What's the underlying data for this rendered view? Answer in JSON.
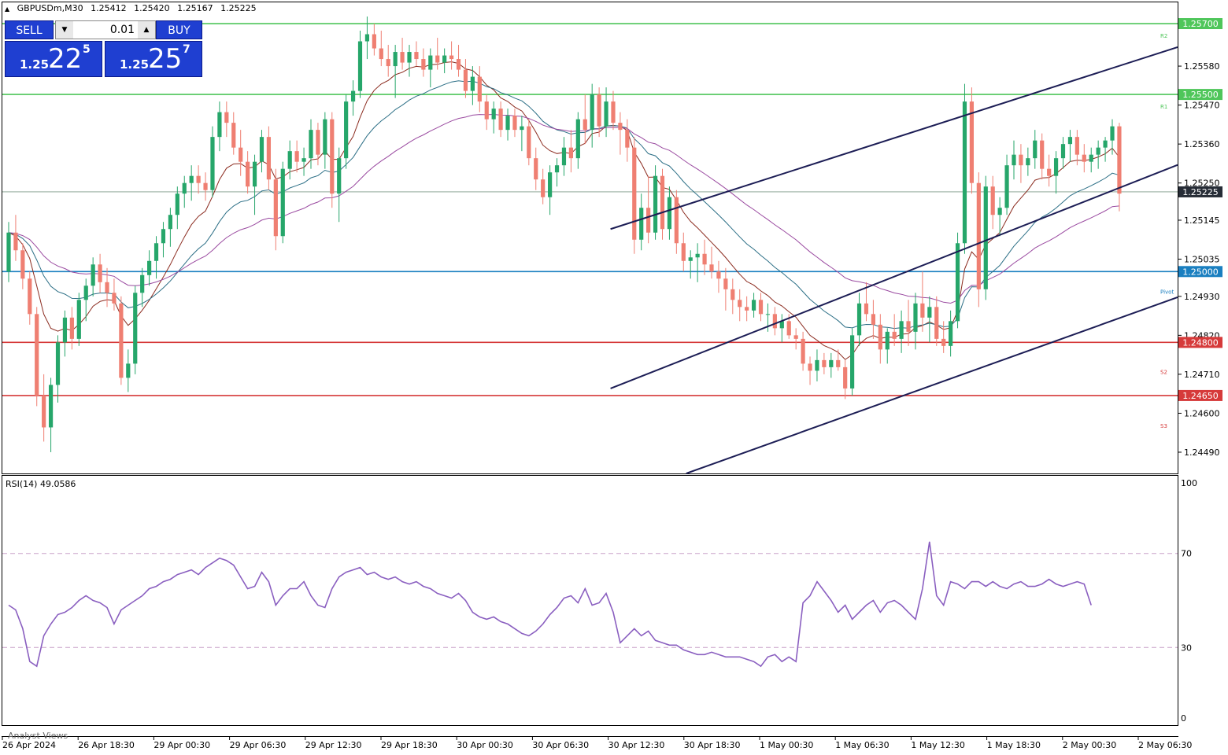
{
  "header": {
    "symbol": "GBPUSDm,M30",
    "open": "1.25412",
    "high": "1.25420",
    "low": "1.25167",
    "close": "1.25225"
  },
  "trade_panel": {
    "sell_label": "SELL",
    "buy_label": "BUY",
    "lot": "0.01",
    "sell_prefix": "1.25",
    "sell_big": "22",
    "sell_sup": "5",
    "buy_prefix": "1.25",
    "buy_big": "25",
    "buy_sup": "7"
  },
  "colors": {
    "bull": "#26a66a",
    "bear": "#ef7f72",
    "resistance": "#4fc65a",
    "support": "#d63a3a",
    "pivot": "#1a7fc0",
    "channel": "#1c1d55",
    "ma_fast": "#8b2b1f",
    "ma_mid": "#2c6f86",
    "ma_slow": "#9a4aa0",
    "rsi": "#8a5fc0"
  },
  "chart_data": {
    "type": "candlestick",
    "price_axis": {
      "ticks": [
        "1.25580",
        "1.25470",
        "1.25360",
        "1.25250",
        "1.25145",
        "1.25035",
        "1.24930",
        "1.24820",
        "1.24710",
        "1.24600",
        "1.24490"
      ],
      "range": [
        1.2443,
        1.2576
      ]
    },
    "time_axis": {
      "labels": [
        "26 Apr 2024",
        "26 Apr 18:30",
        "29 Apr 00:30",
        "29 Apr 06:30",
        "29 Apr 12:30",
        "29 Apr 18:30",
        "30 Apr 00:30",
        "30 Apr 06:30",
        "30 Apr 12:30",
        "30 Apr 18:30",
        "1 May 00:30",
        "1 May 06:30",
        "1 May 12:30",
        "1 May 18:30",
        "2 May 00:30",
        "2 May 06:30"
      ]
    },
    "levels": [
      {
        "label": "1.25700",
        "value": 1.257,
        "kind": "resistance",
        "tag": "R2"
      },
      {
        "label": "1.25500",
        "value": 1.255,
        "kind": "resistance",
        "tag": "R1"
      },
      {
        "label": "1.25000",
        "value": 1.25,
        "kind": "pivot",
        "tag": "Pivot"
      },
      {
        "label": "1.24800",
        "value": 1.248,
        "kind": "support",
        "tag": "S2"
      },
      {
        "label": "1.24650",
        "value": 1.2465,
        "kind": "support",
        "tag": "S3"
      }
    ],
    "current_price": {
      "label": "1.25225",
      "value": 1.25225
    },
    "channel_lines": [
      {
        "from": [
          "30 Apr 12:30",
          1.2512
        ],
        "to": [
          "2 May 06:30",
          1.256
        ]
      },
      {
        "from": [
          "30 Apr 12:30",
          1.2467
        ],
        "to": [
          "2 May 06:30",
          1.2526
        ]
      },
      {
        "from": [
          "30 Apr 18:30",
          1.2443
        ],
        "to": [
          "2 May 06:30",
          1.2489
        ]
      }
    ],
    "candles": [
      [
        1.25,
        1.2514,
        1.2497,
        1.2511
      ],
      [
        1.2511,
        1.2516,
        1.2503,
        1.2506
      ],
      [
        1.2506,
        1.2508,
        1.2495,
        1.2498
      ],
      [
        1.2498,
        1.25,
        1.2485,
        1.2488
      ],
      [
        1.2488,
        1.249,
        1.2462,
        1.2465
      ],
      [
        1.2465,
        1.2471,
        1.2452,
        1.2456
      ],
      [
        1.2456,
        1.247,
        1.2449,
        1.2468
      ],
      [
        1.2468,
        1.2482,
        1.2463,
        1.248
      ],
      [
        1.248,
        1.2489,
        1.2476,
        1.2487
      ],
      [
        1.2487,
        1.249,
        1.2478,
        1.2481
      ],
      [
        1.2481,
        1.2494,
        1.2479,
        1.2492
      ],
      [
        1.2492,
        1.2498,
        1.2486,
        1.2496
      ],
      [
        1.2496,
        1.2504,
        1.2493,
        1.2502
      ],
      [
        1.2502,
        1.2505,
        1.2494,
        1.2497
      ],
      [
        1.2497,
        1.2501,
        1.249,
        1.2494
      ],
      [
        1.2494,
        1.2498,
        1.2489,
        1.2491
      ],
      [
        1.2491,
        1.2493,
        1.2468,
        1.247
      ],
      [
        1.247,
        1.2478,
        1.2466,
        1.2474
      ],
      [
        1.2474,
        1.2496,
        1.2471,
        1.2494
      ],
      [
        1.2494,
        1.2501,
        1.249,
        1.2499
      ],
      [
        1.2499,
        1.2506,
        1.2496,
        1.2503
      ],
      [
        1.2503,
        1.251,
        1.2498,
        1.2508
      ],
      [
        1.2508,
        1.2514,
        1.2504,
        1.2512
      ],
      [
        1.2512,
        1.2518,
        1.2507,
        1.2516
      ],
      [
        1.2516,
        1.2524,
        1.2512,
        1.2522
      ],
      [
        1.2522,
        1.2527,
        1.2518,
        1.2525
      ],
      [
        1.2525,
        1.253,
        1.252,
        1.2527
      ],
      [
        1.2527,
        1.253,
        1.2522,
        1.2525
      ],
      [
        1.2525,
        1.2528,
        1.252,
        1.2523
      ],
      [
        1.2523,
        1.2541,
        1.2521,
        1.2538
      ],
      [
        1.2538,
        1.2548,
        1.2534,
        1.2545
      ],
      [
        1.2545,
        1.2548,
        1.2538,
        1.2542
      ],
      [
        1.2542,
        1.2545,
        1.2533,
        1.2535
      ],
      [
        1.2535,
        1.254,
        1.2527,
        1.2531
      ],
      [
        1.2531,
        1.2534,
        1.2522,
        1.2524
      ],
      [
        1.2524,
        1.2533,
        1.2516,
        1.2531
      ],
      [
        1.2531,
        1.254,
        1.2528,
        1.2538
      ],
      [
        1.2538,
        1.2541,
        1.2523,
        1.2526
      ],
      [
        1.2526,
        1.2529,
        1.2506,
        1.251
      ],
      [
        1.251,
        1.2531,
        1.2508,
        1.2529
      ],
      [
        1.2529,
        1.2537,
        1.2526,
        1.2534
      ],
      [
        1.2534,
        1.2537,
        1.2528,
        1.2531
      ],
      [
        1.2531,
        1.2535,
        1.2527,
        1.2532
      ],
      [
        1.2532,
        1.2543,
        1.2529,
        1.254
      ],
      [
        1.254,
        1.2542,
        1.253,
        1.2533
      ],
      [
        1.2533,
        1.2545,
        1.2529,
        1.2543
      ],
      [
        1.2543,
        1.2545,
        1.2518,
        1.2522
      ],
      [
        1.2522,
        1.2535,
        1.2514,
        1.2532
      ],
      [
        1.2532,
        1.255,
        1.2529,
        1.2548
      ],
      [
        1.2548,
        1.2554,
        1.2544,
        1.2551
      ],
      [
        1.2551,
        1.2568,
        1.2549,
        1.2565
      ],
      [
        1.2565,
        1.2572,
        1.256,
        1.2567
      ],
      [
        1.2567,
        1.257,
        1.2561,
        1.2563
      ],
      [
        1.2563,
        1.2568,
        1.2558,
        1.256
      ],
      [
        1.256,
        1.2564,
        1.2555,
        1.2558
      ],
      [
        1.2558,
        1.2564,
        1.2549,
        1.2562
      ],
      [
        1.2562,
        1.2566,
        1.2557,
        1.2559
      ],
      [
        1.2559,
        1.2564,
        1.2555,
        1.2562
      ],
      [
        1.2562,
        1.2565,
        1.2558,
        1.256
      ],
      [
        1.256,
        1.2563,
        1.2555,
        1.2557
      ],
      [
        1.2557,
        1.2563,
        1.2552,
        1.2561
      ],
      [
        1.2561,
        1.2566,
        1.2557,
        1.2559
      ],
      [
        1.2559,
        1.2563,
        1.2556,
        1.2561
      ],
      [
        1.2561,
        1.2565,
        1.2557,
        1.256
      ],
      [
        1.256,
        1.2564,
        1.2555,
        1.2557
      ],
      [
        1.2557,
        1.256,
        1.2549,
        1.2551
      ],
      [
        1.2551,
        1.2558,
        1.2547,
        1.2555
      ],
      [
        1.2555,
        1.2558,
        1.2545,
        1.2548
      ],
      [
        1.2548,
        1.255,
        1.254,
        1.2543
      ],
      [
        1.2543,
        1.2548,
        1.2539,
        1.2546
      ],
      [
        1.2546,
        1.2548,
        1.2538,
        1.254
      ],
      [
        1.254,
        1.2546,
        1.2537,
        1.2544
      ],
      [
        1.2544,
        1.2546,
        1.2538,
        1.254
      ],
      [
        1.254,
        1.2544,
        1.2534,
        1.2541
      ],
      [
        1.2541,
        1.2543,
        1.253,
        1.2532
      ],
      [
        1.2532,
        1.2535,
        1.2523,
        1.2526
      ],
      [
        1.2526,
        1.2529,
        1.2519,
        1.2521
      ],
      [
        1.2521,
        1.253,
        1.2516,
        1.2528
      ],
      [
        1.2528,
        1.2532,
        1.2524,
        1.253
      ],
      [
        1.253,
        1.2538,
        1.2527,
        1.2535
      ],
      [
        1.2535,
        1.254,
        1.2528,
        1.2532
      ],
      [
        1.2532,
        1.2545,
        1.2529,
        1.2543
      ],
      [
        1.2543,
        1.255,
        1.2536,
        1.254
      ],
      [
        1.254,
        1.2553,
        1.2535,
        1.255
      ],
      [
        1.255,
        1.2552,
        1.2538,
        1.2541
      ],
      [
        1.2541,
        1.2552,
        1.2538,
        1.2548
      ],
      [
        1.2548,
        1.2551,
        1.254,
        1.2542
      ],
      [
        1.2542,
        1.2545,
        1.2533,
        1.254
      ],
      [
        1.254,
        1.2543,
        1.2531,
        1.2535
      ],
      [
        1.2535,
        1.2538,
        1.2505,
        1.2509
      ],
      [
        1.2509,
        1.2522,
        1.2506,
        1.2518
      ],
      [
        1.2518,
        1.2527,
        1.2508,
        1.2511
      ],
      [
        1.2511,
        1.253,
        1.2509,
        1.2527
      ],
      [
        1.2527,
        1.2529,
        1.2509,
        1.2512
      ],
      [
        1.2512,
        1.2524,
        1.2509,
        1.2521
      ],
      [
        1.2521,
        1.2523,
        1.2505,
        1.2508
      ],
      [
        1.2508,
        1.2511,
        1.25,
        1.2503
      ],
      [
        1.2503,
        1.2506,
        1.2498,
        1.2504
      ],
      [
        1.2504,
        1.2508,
        1.2497,
        1.2505
      ],
      [
        1.2505,
        1.2509,
        1.2499,
        1.2502
      ],
      [
        1.2502,
        1.2507,
        1.2498,
        1.25
      ],
      [
        1.25,
        1.2503,
        1.2494,
        1.2498
      ],
      [
        1.2498,
        1.2501,
        1.2489,
        1.2495
      ],
      [
        1.2495,
        1.2498,
        1.2488,
        1.2492
      ],
      [
        1.2492,
        1.2495,
        1.2486,
        1.249
      ],
      [
        1.249,
        1.2493,
        1.2486,
        1.2489
      ],
      [
        1.2489,
        1.2494,
        1.2487,
        1.2492
      ],
      [
        1.2492,
        1.2494,
        1.2486,
        1.2488
      ],
      [
        1.2488,
        1.2491,
        1.2483,
        1.2488
      ],
      [
        1.2488,
        1.249,
        1.2482,
        1.2484
      ],
      [
        1.2484,
        1.2488,
        1.248,
        1.2486
      ],
      [
        1.2486,
        1.2488,
        1.2481,
        1.2482
      ],
      [
        1.2482,
        1.2484,
        1.2478,
        1.2481
      ],
      [
        1.2481,
        1.2483,
        1.2472,
        1.2474
      ],
      [
        1.2474,
        1.2476,
        1.2468,
        1.2472
      ],
      [
        1.2472,
        1.2478,
        1.2469,
        1.2475
      ],
      [
        1.2475,
        1.2477,
        1.2471,
        1.2473
      ],
      [
        1.2473,
        1.2477,
        1.247,
        1.2475
      ],
      [
        1.2475,
        1.2478,
        1.2472,
        1.2473
      ],
      [
        1.2473,
        1.2475,
        1.2464,
        1.2467
      ],
      [
        1.2467,
        1.2484,
        1.2465,
        1.2482
      ],
      [
        1.2482,
        1.2494,
        1.2479,
        1.2491
      ],
      [
        1.2491,
        1.2497,
        1.2486,
        1.2488
      ],
      [
        1.2488,
        1.2492,
        1.2481,
        1.2485
      ],
      [
        1.2485,
        1.2488,
        1.2474,
        1.2478
      ],
      [
        1.2478,
        1.2484,
        1.2474,
        1.2483
      ],
      [
        1.2483,
        1.2488,
        1.2479,
        1.2481
      ],
      [
        1.2481,
        1.2489,
        1.2477,
        1.2486
      ],
      [
        1.2486,
        1.2492,
        1.2479,
        1.2483
      ],
      [
        1.2483,
        1.2494,
        1.2478,
        1.2491
      ],
      [
        1.2491,
        1.25,
        1.2483,
        1.2487
      ],
      [
        1.2487,
        1.2493,
        1.248,
        1.249
      ],
      [
        1.249,
        1.2493,
        1.2479,
        1.2481
      ],
      [
        1.2481,
        1.2486,
        1.2477,
        1.2479
      ],
      [
        1.2479,
        1.2489,
        1.2476,
        1.2486
      ],
      [
        1.2486,
        1.2511,
        1.2484,
        1.2508
      ],
      [
        1.2508,
        1.2553,
        1.2505,
        1.2548
      ],
      [
        1.2548,
        1.2552,
        1.2522,
        1.2525
      ],
      [
        1.2525,
        1.2528,
        1.249,
        1.2495
      ],
      [
        1.2495,
        1.2527,
        1.2492,
        1.2524
      ],
      [
        1.2524,
        1.2527,
        1.2512,
        1.2516
      ],
      [
        1.2516,
        1.2521,
        1.251,
        1.2518
      ],
      [
        1.2518,
        1.2533,
        1.2516,
        1.253
      ],
      [
        1.253,
        1.2537,
        1.2526,
        1.2533
      ],
      [
        1.2533,
        1.2536,
        1.2525,
        1.253
      ],
      [
        1.253,
        1.2535,
        1.2527,
        1.2532
      ],
      [
        1.2532,
        1.254,
        1.2529,
        1.2537
      ],
      [
        1.2537,
        1.2539,
        1.2526,
        1.2529
      ],
      [
        1.2529,
        1.2533,
        1.2524,
        1.2527
      ],
      [
        1.2527,
        1.2534,
        1.2522,
        1.2532
      ],
      [
        1.2532,
        1.2538,
        1.2529,
        1.2536
      ],
      [
        1.2536,
        1.254,
        1.2531,
        1.2538
      ],
      [
        1.2538,
        1.254,
        1.253,
        1.2533
      ],
      [
        1.2533,
        1.2536,
        1.2528,
        1.2531
      ],
      [
        1.2531,
        1.2535,
        1.2528,
        1.2533
      ],
      [
        1.2533,
        1.2537,
        1.2529,
        1.2535
      ],
      [
        1.2535,
        1.2538,
        1.2531,
        1.2537
      ],
      [
        1.2537,
        1.2543,
        1.2533,
        1.2541
      ],
      [
        1.2541,
        1.2542,
        1.2517,
        1.2522
      ]
    ],
    "rsi": {
      "label": "RSI(14) 49.0586",
      "period": 14,
      "value": 49.0586,
      "levels": [
        70,
        30
      ],
      "axis_ticks": [
        "100",
        "70",
        "30",
        "0"
      ],
      "values": [
        48,
        46,
        38,
        24,
        22,
        35,
        40,
        44,
        45,
        47,
        50,
        52,
        50,
        49,
        47,
        40,
        46,
        48,
        50,
        52,
        55,
        56,
        58,
        59,
        61,
        62,
        63,
        61,
        64,
        66,
        68,
        67,
        65,
        60,
        55,
        56,
        62,
        58,
        48,
        52,
        55,
        55,
        58,
        52,
        48,
        47,
        55,
        60,
        62,
        63,
        64,
        61,
        62,
        60,
        59,
        60,
        58,
        57,
        58,
        56,
        55,
        53,
        52,
        51,
        53,
        50,
        45,
        43,
        42,
        43,
        41,
        40,
        38,
        36,
        35,
        37,
        40,
        44,
        47,
        51,
        52,
        49,
        55,
        48,
        49,
        53,
        45,
        32,
        35,
        38,
        35,
        37,
        33,
        32,
        31,
        31,
        29,
        28,
        27,
        27,
        28,
        27,
        26,
        26,
        26,
        25,
        24,
        22,
        26,
        27,
        24,
        26,
        24,
        49,
        52,
        58,
        54,
        50,
        45,
        48,
        42,
        45,
        48,
        50,
        45,
        49,
        50,
        48,
        45,
        42,
        55,
        75,
        52,
        48,
        58,
        57,
        55,
        58,
        58,
        56,
        58,
        56,
        55,
        57,
        58,
        56,
        56,
        57,
        59,
        57,
        56,
        57,
        58,
        57,
        48
      ],
      "extra_label": "Analyst Views"
    }
  }
}
